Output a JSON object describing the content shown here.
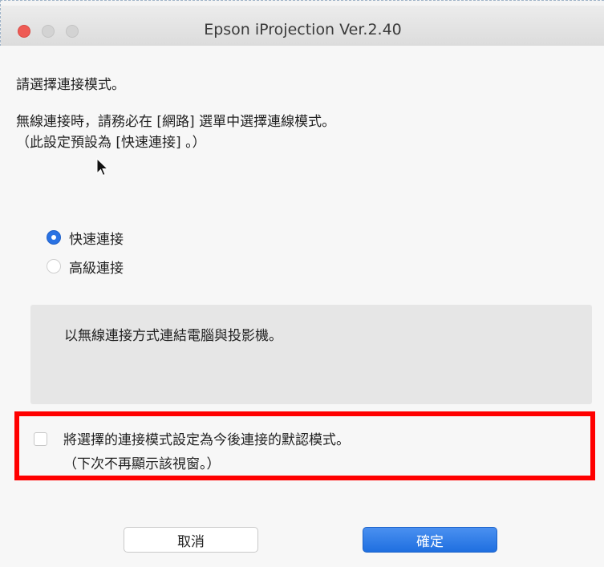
{
  "window": {
    "title": "Epson iProjection Ver.2.40"
  },
  "instructions": {
    "line1": "請選擇連接模式。",
    "line2": "無線連接時，請務必在 [網路] 選單中選擇連線模式。",
    "line3": "（此設定預設為 [快速連接] 。）"
  },
  "connection_mode": {
    "options": [
      {
        "label": "快速連接",
        "selected": true
      },
      {
        "label": "高級連接",
        "selected": false
      }
    ]
  },
  "description": {
    "text": "以無線連接方式連結電腦與投影機。"
  },
  "default_checkbox": {
    "checked": false,
    "line1": "將選擇的連接模式設定為今後連接的默認模式。",
    "line2": "（下次不再顯示該視窗。）"
  },
  "buttons": {
    "cancel": "取消",
    "ok": "確定"
  },
  "colors": {
    "accent": "#2a72e3",
    "highlight_border": "#ff0000"
  }
}
